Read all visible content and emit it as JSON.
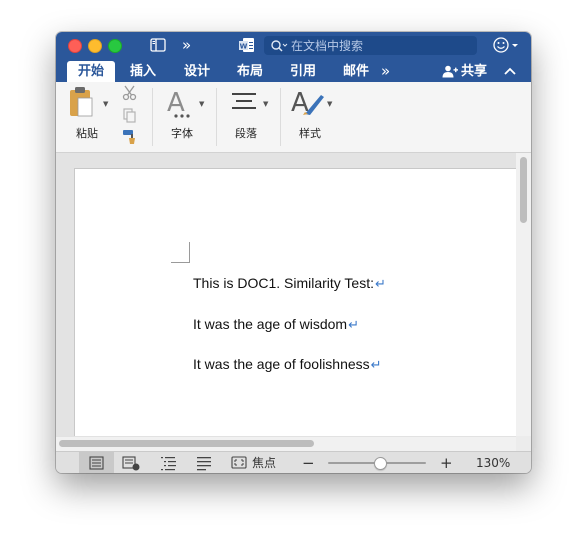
{
  "titlebar": {
    "search_placeholder": "在文档中搜索"
  },
  "ribbon_tabs": [
    {
      "label": "开始",
      "active": true
    },
    {
      "label": "插入"
    },
    {
      "label": "设计"
    },
    {
      "label": "布局"
    },
    {
      "label": "引用"
    },
    {
      "label": "邮件"
    }
  ],
  "share_label": "共享",
  "ribbon": {
    "paste_label": "粘贴",
    "font_label": "字体",
    "paragraph_label": "段落",
    "styles_label": "样式"
  },
  "document": {
    "paragraphs": [
      "This is DOC1. Similarity Test:",
      "It was the age of wisdom",
      "It was the age of foolishness"
    ]
  },
  "statusbar": {
    "focus_label": "焦点",
    "zoom_level": "130%"
  },
  "colors": {
    "brand": "#2b579a",
    "paragraph_mark": "#3a78c9"
  }
}
